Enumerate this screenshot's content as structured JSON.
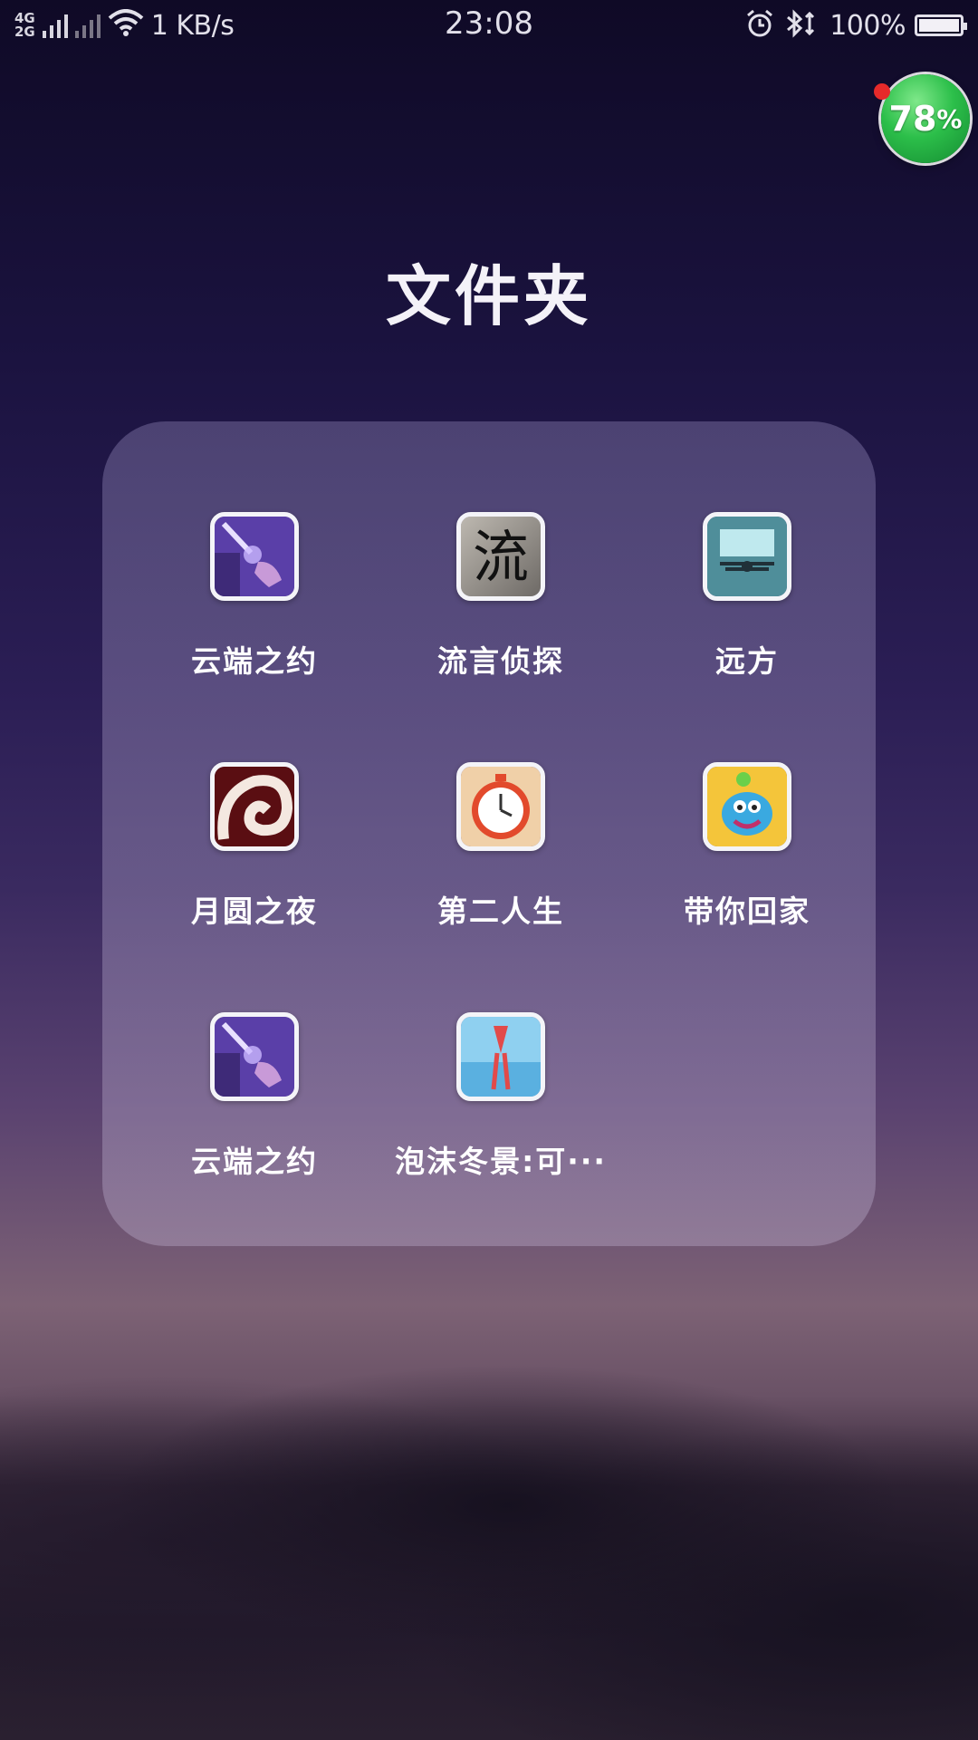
{
  "status_bar": {
    "network_top": "4G",
    "network_bottom": "2G",
    "speed": "1 KB/s",
    "time": "23:08",
    "battery_text": "100%",
    "battery_level": 1.0,
    "icons": [
      "signal-icon",
      "wifi-icon",
      "alarm-icon",
      "bluetooth-icon",
      "battery-icon"
    ]
  },
  "memory_badge": {
    "text": "78",
    "unit": "%"
  },
  "folder": {
    "title": "文件夹",
    "apps": [
      {
        "label": "云端之约",
        "icon": "magic-hand-icon"
      },
      {
        "label": "流言侦探",
        "icon": "liu-character-icon"
      },
      {
        "label": "远方",
        "icon": "biplane-icon"
      },
      {
        "label": "月圆之夜",
        "icon": "swirl-icon"
      },
      {
        "label": "第二人生",
        "icon": "stopwatch-icon"
      },
      {
        "label": "带你回家",
        "icon": "monster-icon"
      },
      {
        "label": "云端之约",
        "icon": "magic-hand-icon"
      },
      {
        "label": "泡沫冬景:可···",
        "icon": "ice-icon"
      }
    ]
  },
  "colors": {
    "badge_green": "#2cbf4a",
    "notification_red": "#e62a2a"
  }
}
